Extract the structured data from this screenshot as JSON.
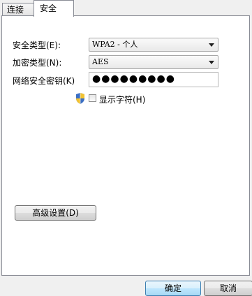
{
  "tabs": {
    "connect": "连接",
    "security": "安全"
  },
  "security_type": {
    "label": "安全类型(E):",
    "value": "WPA2 - 个人"
  },
  "encryption_type": {
    "label": "加密类型(N):",
    "value": "AES"
  },
  "network_key": {
    "label": "网络安全密钥(K)",
    "value": "●●●●●●●●●"
  },
  "show_chars": {
    "label": "显示字符(H)",
    "checked": false
  },
  "buttons": {
    "advanced": "高级设置(D)",
    "ok": "确定",
    "cancel": "取消"
  },
  "colors": {
    "panel": "#ffffff",
    "window": "#f0f0f0",
    "border": "#898c95"
  }
}
